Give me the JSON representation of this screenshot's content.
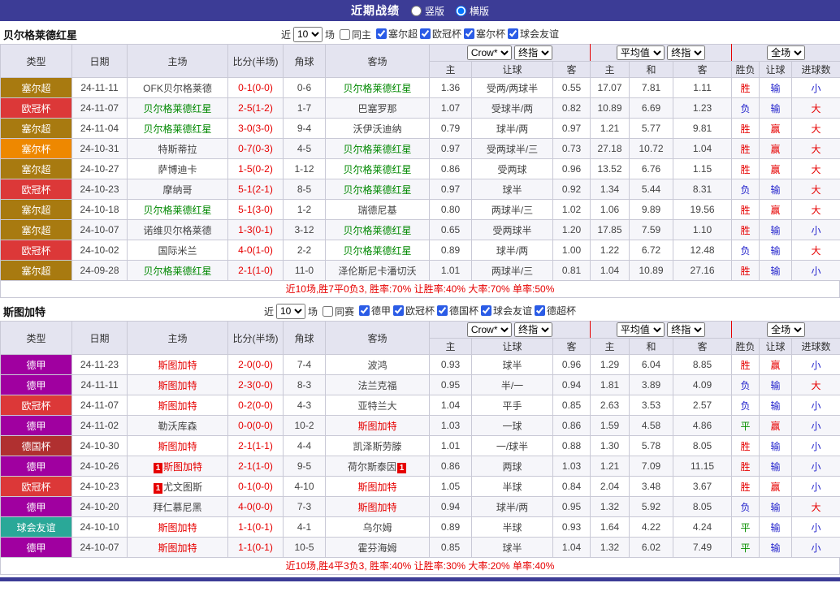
{
  "topbar": {
    "title": "近期战绩",
    "vertical": "竖版",
    "horizontal": "横版"
  },
  "table_header": {
    "type": "类型",
    "date": "日期",
    "home": "主场",
    "score": "比分(半场)",
    "corner": "角球",
    "away": "客场",
    "odds_source": "Crow*",
    "odds_kind": "终指",
    "avg_source": "平均值",
    "avg_kind": "终指",
    "scope": "全场",
    "home_odds": "主",
    "handicap": "让球",
    "away_odds": "客",
    "avg_home": "主",
    "avg_draw": "和",
    "avg_away": "客",
    "result": "胜负",
    "handicap_result": "让球",
    "goals": "进球数"
  },
  "league_colors": {
    "塞尔超": "#a87a10",
    "欧冠杯": "#dc3838",
    "塞尔杯": "#ee8800",
    "德甲": "#a000a0",
    "德国杯": "#b03030",
    "球会友谊": "#2aa898"
  },
  "result_colors": {
    "red": "#e60000",
    "blue": "#2323cc",
    "green": "#089000"
  },
  "sections": [
    {
      "team": "贝尔格莱德红星",
      "hl_color": "#008800",
      "filter": {
        "near": "近",
        "count": "10",
        "unit": "场",
        "same": "同主",
        "leagues": [
          "塞尔超",
          "欧冠杯",
          "塞尔杯",
          "球会友谊"
        ]
      },
      "rows": [
        {
          "type": "塞尔超",
          "date": "24-11-11",
          "home": "OFK贝尔格莱德",
          "home_hl": false,
          "score": "0-1(0-0)",
          "corner": "0-6",
          "away": "贝尔格莱德红星",
          "away_hl": true,
          "o1": "1.36",
          "o2": "受两/两球半",
          "o3": "0.55",
          "a1": "17.07",
          "a2": "7.81",
          "a3": "1.11",
          "r1": "胜",
          "r1c": "red",
          "r2": "输",
          "r2c": "blue",
          "r3": "小",
          "r3c": "blue"
        },
        {
          "type": "欧冠杯",
          "date": "24-11-07",
          "home": "贝尔格莱德红星",
          "home_hl": true,
          "score": "2-5(1-2)",
          "corner": "1-7",
          "away": "巴塞罗那",
          "away_hl": false,
          "o1": "1.07",
          "o2": "受球半/两",
          "o3": "0.82",
          "a1": "10.89",
          "a2": "6.69",
          "a3": "1.23",
          "r1": "负",
          "r1c": "blue",
          "r2": "输",
          "r2c": "blue",
          "r3": "大",
          "r3c": "red"
        },
        {
          "type": "塞尔超",
          "date": "24-11-04",
          "home": "贝尔格莱德红星",
          "home_hl": true,
          "score": "3-0(3-0)",
          "corner": "9-4",
          "away": "沃伊沃迪纳",
          "away_hl": false,
          "o1": "0.79",
          "o2": "球半/两",
          "o3": "0.97",
          "a1": "1.21",
          "a2": "5.77",
          "a3": "9.81",
          "r1": "胜",
          "r1c": "red",
          "r2": "赢",
          "r2c": "red",
          "r3": "大",
          "r3c": "red"
        },
        {
          "type": "塞尔杯",
          "date": "24-10-31",
          "home": "特斯蒂拉",
          "home_hl": false,
          "score": "0-7(0-3)",
          "corner": "4-5",
          "away": "贝尔格莱德红星",
          "away_hl": true,
          "o1": "0.97",
          "o2": "受两球半/三",
          "o3": "0.73",
          "a1": "27.18",
          "a2": "10.72",
          "a3": "1.04",
          "r1": "胜",
          "r1c": "red",
          "r2": "赢",
          "r2c": "red",
          "r3": "大",
          "r3c": "red"
        },
        {
          "type": "塞尔超",
          "date": "24-10-27",
          "home": "萨博迪卡",
          "home_hl": false,
          "score": "1-5(0-2)",
          "corner": "1-12",
          "away": "贝尔格莱德红星",
          "away_hl": true,
          "o1": "0.86",
          "o2": "受两球",
          "o3": "0.96",
          "a1": "13.52",
          "a2": "6.76",
          "a3": "1.15",
          "r1": "胜",
          "r1c": "red",
          "r2": "赢",
          "r2c": "red",
          "r3": "大",
          "r3c": "red"
        },
        {
          "type": "欧冠杯",
          "date": "24-10-23",
          "home": "摩纳哥",
          "home_hl": false,
          "score": "5-1(2-1)",
          "corner": "8-5",
          "away": "贝尔格莱德红星",
          "away_hl": true,
          "o1": "0.97",
          "o2": "球半",
          "o3": "0.92",
          "a1": "1.34",
          "a2": "5.44",
          "a3": "8.31",
          "r1": "负",
          "r1c": "blue",
          "r2": "输",
          "r2c": "blue",
          "r3": "大",
          "r3c": "red"
        },
        {
          "type": "塞尔超",
          "date": "24-10-18",
          "home": "贝尔格莱德红星",
          "home_hl": true,
          "score": "5-1(3-0)",
          "corner": "1-2",
          "away": "瑞德尼基",
          "away_hl": false,
          "o1": "0.80",
          "o2": "两球半/三",
          "o3": "1.02",
          "a1": "1.06",
          "a2": "9.89",
          "a3": "19.56",
          "r1": "胜",
          "r1c": "red",
          "r2": "赢",
          "r2c": "red",
          "r3": "大",
          "r3c": "red"
        },
        {
          "type": "塞尔超",
          "date": "24-10-07",
          "home": "诺维贝尔格莱德",
          "home_hl": false,
          "score": "1-3(0-1)",
          "corner": "3-12",
          "away": "贝尔格莱德红星",
          "away_hl": true,
          "o1": "0.65",
          "o2": "受两球半",
          "o3": "1.20",
          "a1": "17.85",
          "a2": "7.59",
          "a3": "1.10",
          "r1": "胜",
          "r1c": "red",
          "r2": "输",
          "r2c": "blue",
          "r3": "小",
          "r3c": "blue"
        },
        {
          "type": "欧冠杯",
          "date": "24-10-02",
          "home": "国际米兰",
          "home_hl": false,
          "score": "4-0(1-0)",
          "corner": "2-2",
          "away": "贝尔格莱德红星",
          "away_hl": true,
          "o1": "0.89",
          "o2": "球半/两",
          "o3": "1.00",
          "a1": "1.22",
          "a2": "6.72",
          "a3": "12.48",
          "r1": "负",
          "r1c": "blue",
          "r2": "输",
          "r2c": "blue",
          "r3": "大",
          "r3c": "red"
        },
        {
          "type": "塞尔超",
          "date": "24-09-28",
          "home": "贝尔格莱德红星",
          "home_hl": true,
          "score": "2-1(1-0)",
          "corner": "11-0",
          "away": "泽伦斯尼卡潘切沃",
          "away_hl": false,
          "o1": "1.01",
          "o2": "两球半/三",
          "o3": "0.81",
          "a1": "1.04",
          "a2": "10.89",
          "a3": "27.16",
          "r1": "胜",
          "r1c": "red",
          "r2": "输",
          "r2c": "blue",
          "r3": "小",
          "r3c": "blue"
        }
      ],
      "summary": "近10场,胜7平0负3, 胜率:70% 让胜率:40% 大率:70% 单率:50%"
    },
    {
      "team": "斯图加特",
      "hl_color": "#e60000",
      "filter": {
        "near": "近",
        "count": "10",
        "unit": "场",
        "same": "同赛",
        "leagues": [
          "德甲",
          "欧冠杯",
          "德国杯",
          "球会友谊",
          "德超杯"
        ]
      },
      "rows": [
        {
          "type": "德甲",
          "date": "24-11-23",
          "home": "斯图加特",
          "home_hl": true,
          "score": "2-0(0-0)",
          "corner": "7-4",
          "away": "波鸿",
          "away_hl": false,
          "o1": "0.93",
          "o2": "球半",
          "o3": "0.96",
          "a1": "1.29",
          "a2": "6.04",
          "a3": "8.85",
          "r1": "胜",
          "r1c": "red",
          "r2": "赢",
          "r2c": "red",
          "r3": "小",
          "r3c": "blue"
        },
        {
          "type": "德甲",
          "date": "24-11-11",
          "home": "斯图加特",
          "home_hl": true,
          "score": "2-3(0-0)",
          "corner": "8-3",
          "away": "法兰克福",
          "away_hl": false,
          "o1": "0.95",
          "o2": "半/一",
          "o3": "0.94",
          "a1": "1.81",
          "a2": "3.89",
          "a3": "4.09",
          "r1": "负",
          "r1c": "blue",
          "r2": "输",
          "r2c": "blue",
          "r3": "大",
          "r3c": "red"
        },
        {
          "type": "欧冠杯",
          "date": "24-11-07",
          "home": "斯图加特",
          "home_hl": true,
          "score": "0-2(0-0)",
          "corner": "4-3",
          "away": "亚特兰大",
          "away_hl": false,
          "o1": "1.04",
          "o2": "平手",
          "o3": "0.85",
          "a1": "2.63",
          "a2": "3.53",
          "a3": "2.57",
          "r1": "负",
          "r1c": "blue",
          "r2": "输",
          "r2c": "blue",
          "r3": "小",
          "r3c": "blue"
        },
        {
          "type": "德甲",
          "date": "24-11-02",
          "home": "勒沃库森",
          "home_hl": false,
          "score": "0-0(0-0)",
          "corner": "10-2",
          "away": "斯图加特",
          "away_hl": true,
          "o1": "1.03",
          "o2": "一球",
          "o3": "0.86",
          "a1": "1.59",
          "a2": "4.58",
          "a3": "4.86",
          "r1": "平",
          "r1c": "green",
          "r2": "赢",
          "r2c": "red",
          "r3": "小",
          "r3c": "blue"
        },
        {
          "type": "德国杯",
          "date": "24-10-30",
          "home": "斯图加特",
          "home_hl": true,
          "score": "2-1(1-1)",
          "corner": "4-4",
          "away": "凯泽斯劳滕",
          "away_hl": false,
          "o1": "1.01",
          "o2": "一/球半",
          "o3": "0.88",
          "a1": "1.30",
          "a2": "5.78",
          "a3": "8.05",
          "r1": "胜",
          "r1c": "red",
          "r2": "输",
          "r2c": "blue",
          "r3": "小",
          "r3c": "blue"
        },
        {
          "type": "德甲",
          "date": "24-10-26",
          "home": "斯图加特",
          "home_hl": true,
          "home_card": "1",
          "score": "2-1(1-0)",
          "corner": "9-5",
          "away": "荷尔斯泰因",
          "away_hl": false,
          "away_card": "1",
          "o1": "0.86",
          "o2": "两球",
          "o3": "1.03",
          "a1": "1.21",
          "a2": "7.09",
          "a3": "11.15",
          "r1": "胜",
          "r1c": "red",
          "r2": "输",
          "r2c": "blue",
          "r3": "小",
          "r3c": "blue"
        },
        {
          "type": "欧冠杯",
          "date": "24-10-23",
          "home": "尤文图斯",
          "home_hl": false,
          "home_card": "1",
          "score": "0-1(0-0)",
          "corner": "4-10",
          "away": "斯图加特",
          "away_hl": true,
          "o1": "1.05",
          "o2": "半球",
          "o3": "0.84",
          "a1": "2.04",
          "a2": "3.48",
          "a3": "3.67",
          "r1": "胜",
          "r1c": "red",
          "r2": "赢",
          "r2c": "red",
          "r3": "小",
          "r3c": "blue"
        },
        {
          "type": "德甲",
          "date": "24-10-20",
          "home": "拜仁慕尼黑",
          "home_hl": false,
          "score": "4-0(0-0)",
          "corner": "7-3",
          "away": "斯图加特",
          "away_hl": true,
          "o1": "0.94",
          "o2": "球半/两",
          "o3": "0.95",
          "a1": "1.32",
          "a2": "5.92",
          "a3": "8.05",
          "r1": "负",
          "r1c": "blue",
          "r2": "输",
          "r2c": "blue",
          "r3": "大",
          "r3c": "red"
        },
        {
          "type": "球会友谊",
          "date": "24-10-10",
          "home": "斯图加特",
          "home_hl": true,
          "score": "1-1(0-1)",
          "corner": "4-1",
          "away": "乌尔姆",
          "away_hl": false,
          "o1": "0.89",
          "o2": "半球",
          "o3": "0.93",
          "a1": "1.64",
          "a2": "4.22",
          "a3": "4.24",
          "r1": "平",
          "r1c": "green",
          "r2": "输",
          "r2c": "blue",
          "r3": "小",
          "r3c": "blue"
        },
        {
          "type": "德甲",
          "date": "24-10-07",
          "home": "斯图加特",
          "home_hl": true,
          "score": "1-1(0-1)",
          "corner": "10-5",
          "away": "霍芬海姆",
          "away_hl": false,
          "o1": "0.85",
          "o2": "球半",
          "o3": "1.04",
          "a1": "1.32",
          "a2": "6.02",
          "a3": "7.49",
          "r1": "平",
          "r1c": "green",
          "r2": "输",
          "r2c": "blue",
          "r3": "小",
          "r3c": "blue"
        }
      ],
      "summary": "近10场,胜4平3负3, 胜率:40% 让胜率:30% 大率:20% 单率:40%"
    }
  ]
}
